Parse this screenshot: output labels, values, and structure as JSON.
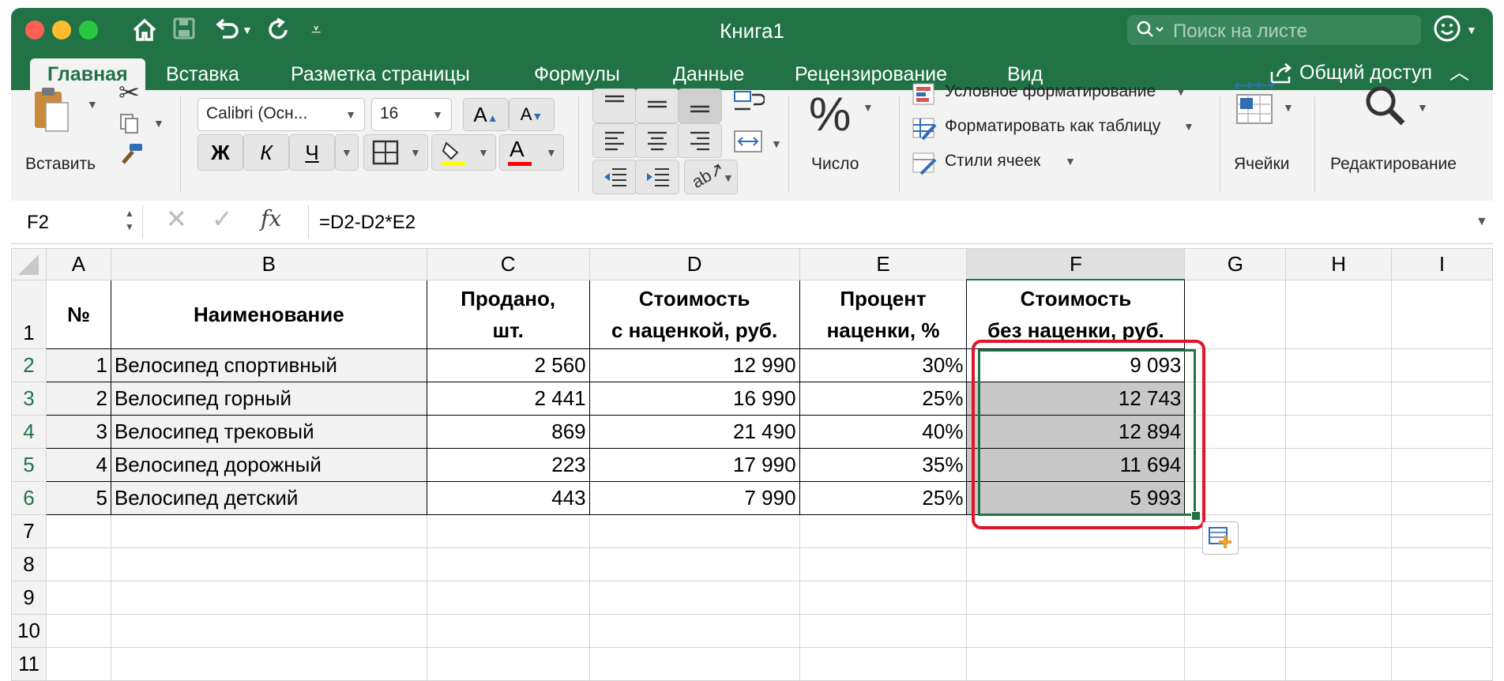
{
  "window": {
    "title": "Книга1",
    "search_placeholder": "Поиск на листе"
  },
  "tabs": [
    "Главная",
    "Вставка",
    "Разметка страницы",
    "Формулы",
    "Данные",
    "Рецензирование",
    "Вид"
  ],
  "share_label": "Общий доступ",
  "ribbon": {
    "paste_label": "Вставить",
    "font_name": "Calibri (Осн...",
    "font_size": "16",
    "bold": "Ж",
    "italic": "К",
    "underline": "Ч",
    "number_label": "Число",
    "conditional_formatting": "Условное форматирование",
    "format_as_table": "Форматировать как таблицу",
    "cell_styles": "Стили ячеек",
    "cells_label": "Ячейки",
    "editing_label": "Редактирование"
  },
  "formula_bar": {
    "name_box": "F2",
    "fx": "fx",
    "formula": "=D2-D2*E2"
  },
  "grid": {
    "columns": [
      "A",
      "B",
      "C",
      "D",
      "E",
      "F",
      "G",
      "H",
      "I"
    ],
    "row_numbers": [
      "1",
      "2",
      "3",
      "4",
      "5",
      "6",
      "7",
      "8",
      "9",
      "10",
      "11"
    ],
    "headers": {
      "a": "№",
      "b": "Наименование",
      "c1": "Продано,",
      "c2": "шт.",
      "d1": "Стоимость",
      "d2": "с наценкой, руб.",
      "e1": "Процент",
      "e2": "наценки, %",
      "f1": "Стоимость",
      "f2": "без наценки, руб."
    },
    "rows": [
      {
        "no": "1",
        "name": "Велосипед спортивный",
        "sold": "2 560",
        "price": "12 990",
        "pct": "30%",
        "net": "9 093"
      },
      {
        "no": "2",
        "name": "Велосипед горный",
        "sold": "2 441",
        "price": "16 990",
        "pct": "25%",
        "net": "12 743"
      },
      {
        "no": "3",
        "name": "Велосипед трековый",
        "sold": "869",
        "price": "21 490",
        "pct": "40%",
        "net": "12 894"
      },
      {
        "no": "4",
        "name": "Велосипед дорожный",
        "sold": "223",
        "price": "17 990",
        "pct": "35%",
        "net": "11 694"
      },
      {
        "no": "5",
        "name": "Велосипед детский",
        "sold": "443",
        "price": "7 990",
        "pct": "25%",
        "net": "5 993"
      }
    ]
  },
  "colors": {
    "excel_green": "#217346",
    "highlight_red": "#e0142a",
    "selection_fill": "#c8c8c8"
  }
}
